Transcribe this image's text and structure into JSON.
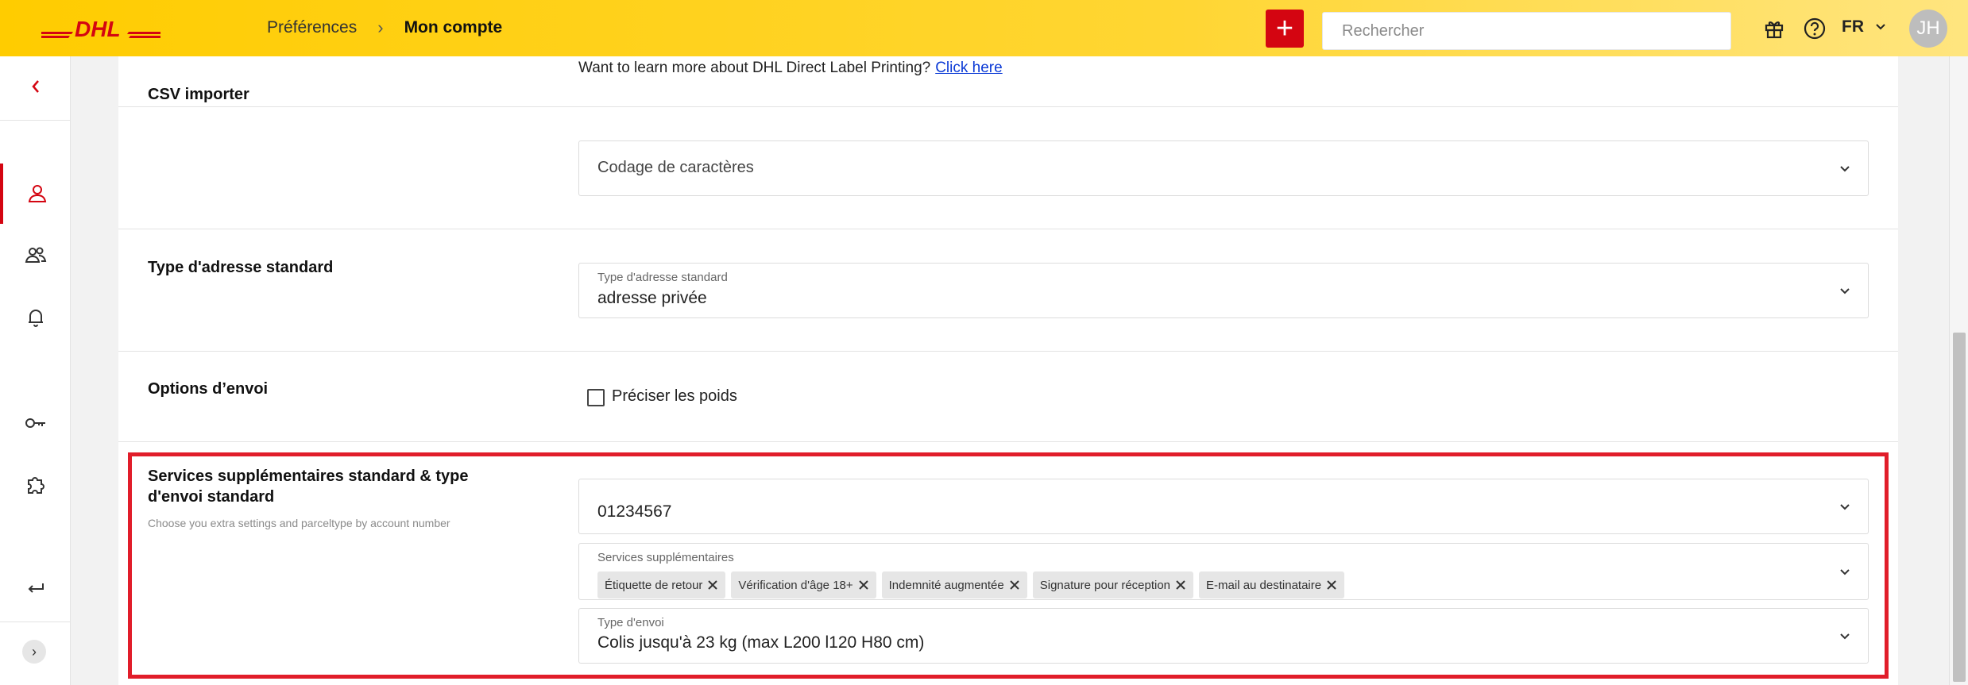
{
  "brand": {
    "logo": "DHL",
    "color": "#d40511",
    "accent": "#ffcc00"
  },
  "header": {
    "breadcrumb": [
      "Préférences",
      "Mon compte"
    ],
    "breadcrumb_sep": "›",
    "add_label": "+",
    "search_placeholder": "Rechercher",
    "icons": [
      "gift-icon",
      "help-icon"
    ],
    "language": "FR",
    "avatar_initials": "JH"
  },
  "sidebar": {
    "items": [
      "back-icon",
      "user-icon",
      "users-icon",
      "bell-icon",
      "key-icon",
      "puzzle-icon",
      "logout-icon"
    ],
    "active": "user-icon",
    "expand_label": "›"
  },
  "content": {
    "dlp": {
      "text": "Want to learn more about DHL Direct Label Printing?",
      "link": "Click here"
    },
    "csv": {
      "title": "CSV importer",
      "placeholder": "Codage de caractères"
    },
    "address_type": {
      "title": "Type d'adresse standard",
      "label": "Type d'adresse standard",
      "value": "adresse privée"
    },
    "shipping_options": {
      "title": "Options d’envoi",
      "checkbox_label": "Préciser les poids",
      "checked": false
    },
    "extra_services": {
      "title_line1": "Services supplémentaires standard & type",
      "title_line2": "d'envoi standard",
      "subtitle": "Choose you extra settings and parceltype by account number",
      "account_number": "01234567",
      "services_label": "Services supplémentaires",
      "services": [
        "Étiquette de retour",
        "Vérification d'âge 18+",
        "Indemnité augmentée",
        "Signature pour réception",
        "E-mail au destinataire"
      ],
      "parcel_label": "Type d'envoi",
      "parcel_value": "Colis jusqu'à 23 kg (max L200 l120 H80 cm)"
    }
  }
}
